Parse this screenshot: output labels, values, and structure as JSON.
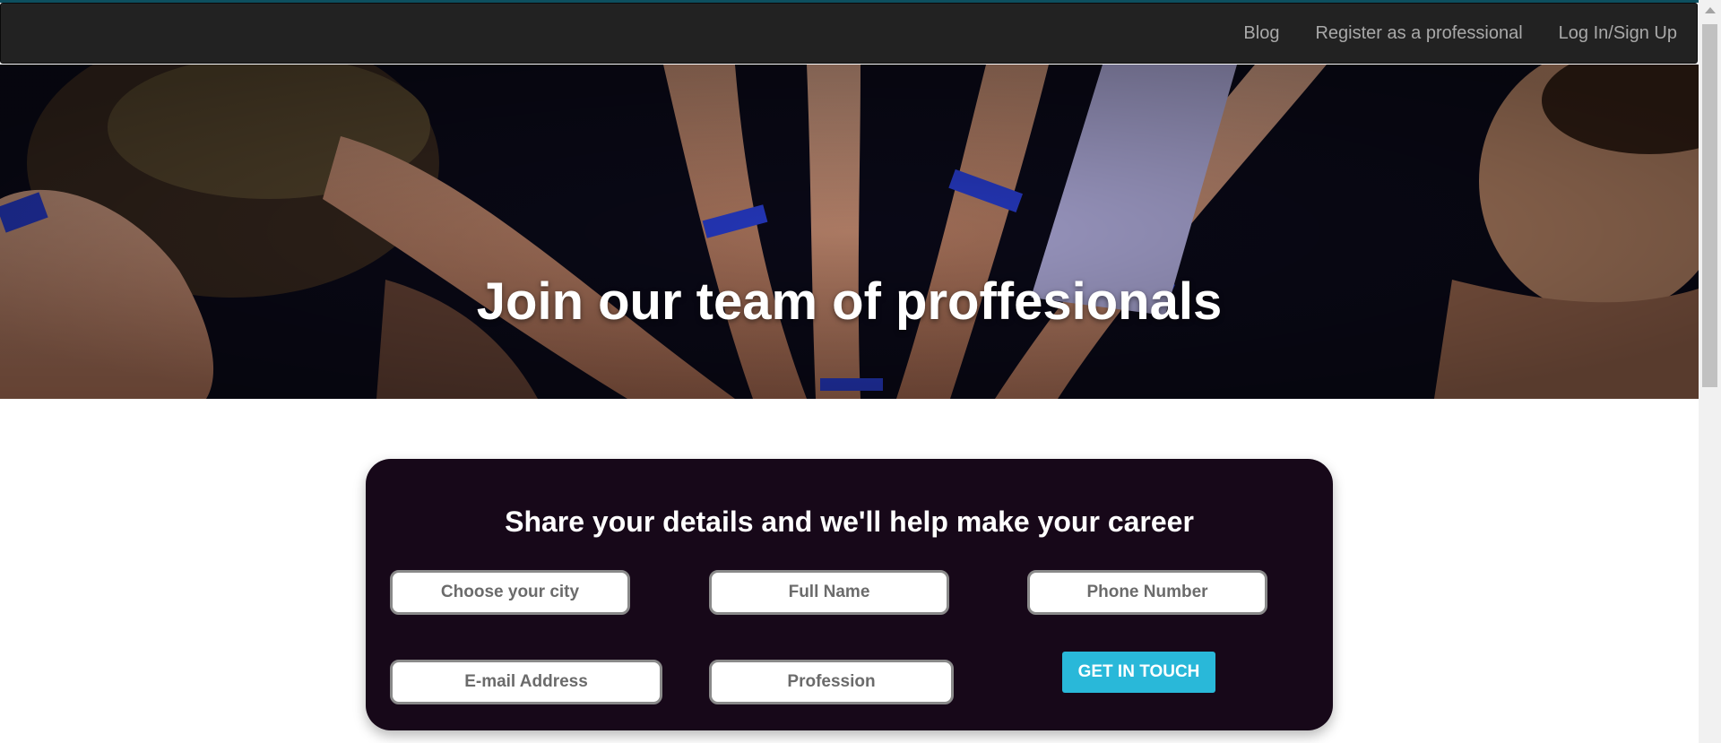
{
  "nav": {
    "items": [
      {
        "label": "Blog"
      },
      {
        "label": "Register as a professional"
      },
      {
        "label": "Log In/Sign Up"
      }
    ]
  },
  "hero": {
    "title": "Join our team of proffesionals"
  },
  "form": {
    "title": "Share your details and we'll help make your career",
    "city_placeholder": "Choose your city",
    "name_placeholder": "Full Name",
    "phone_placeholder": "Phone Number",
    "email_placeholder": "E-mail Address",
    "profession_placeholder": "Profession",
    "submit_label": "GET IN TOUCH"
  },
  "colors": {
    "navbar_bg": "#222222",
    "nav_link": "#a9a9a9",
    "form_bg": "#170819",
    "cta_bg": "#29b8d9",
    "hero_bg": "#0b0a1a",
    "wristband": "#2a3fd6"
  }
}
